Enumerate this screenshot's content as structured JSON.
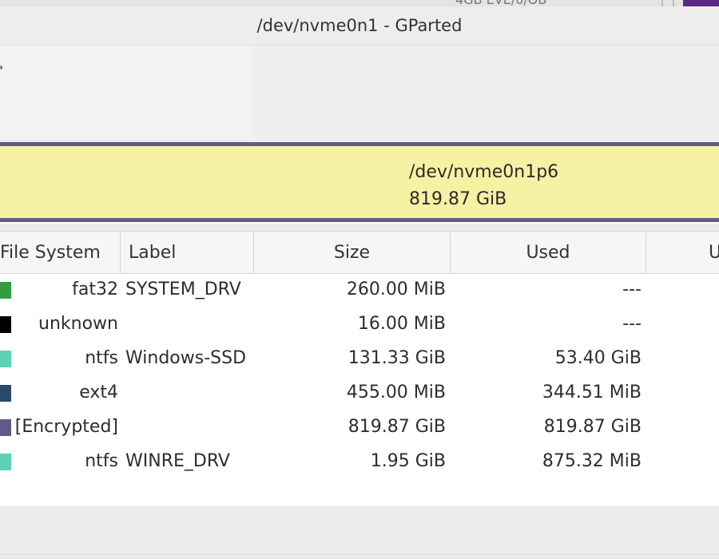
{
  "window": {
    "title": "/dev/nvme0n1 - GParted"
  },
  "background_window": {
    "partial_text": "4GB  EVE/0/OB"
  },
  "toolbar": {
    "partial_icon": "menu-edge-icon"
  },
  "disk_map": {
    "selected_partition": {
      "name": "/dev/nvme0n1p6",
      "size": "819.87 GiB",
      "color": "#f7f1a3",
      "border_color": "#625b86"
    }
  },
  "table": {
    "headers": {
      "file_system": "File System",
      "label": "Label",
      "size": "Size",
      "used": "Used",
      "unused": "U"
    },
    "rows": [
      {
        "fs": "fat32",
        "color": "#2e9e3e",
        "label": "SYSTEM_DRV",
        "size": "260.00 MiB",
        "used": "---"
      },
      {
        "fs": "unknown",
        "color": "#000000",
        "label": "",
        "size": "16.00 MiB",
        "used": "---"
      },
      {
        "fs": "ntfs",
        "color": "#5ed0b3",
        "label": "Windows-SSD",
        "size": "131.33 GiB",
        "used": "53.40 GiB"
      },
      {
        "fs": "ext4",
        "color": "#2a4a6b",
        "label": "",
        "size": "455.00 MiB",
        "used": "344.51 MiB"
      },
      {
        "fs": "[Encrypted]",
        "color": "#5f5a86",
        "label": "",
        "size": "819.87 GiB",
        "used": "819.87 GiB"
      },
      {
        "fs": "ntfs",
        "color": "#5ed0b3",
        "label": "WINRE_DRV",
        "size": "1.95 GiB",
        "used": "875.32 MiB"
      }
    ]
  }
}
